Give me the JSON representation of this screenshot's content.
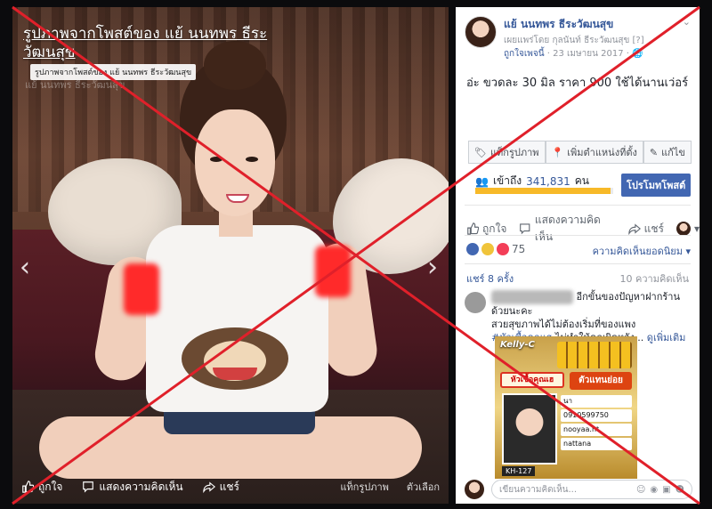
{
  "photo": {
    "title": "รูปภาพจากโพสต์ของ แย้ นนทพร ธีระวัฒนสุข",
    "caption_tag": "รูปภาพจากโพสต์ของ แย้ นนทพร ธีระวัฒนสุข",
    "sub_caption": "แย้ นนทพร ธีระวัฒนสุข",
    "bottom_bar": {
      "like": "ถูกใจ",
      "comment": "แสดงความคิดเห็น",
      "share": "แชร์",
      "tag_photo": "แท็กรูปภาพ",
      "options": "ตัวเลือก"
    },
    "nav_prev": "‹",
    "nav_next": "›"
  },
  "post": {
    "author": "แย้ นนทพร ธีระวัฒนสุข",
    "shared_by": "เผยแพร่โดย กุลนันท์ ธีระวัฒนสุข [?]",
    "page_liked": "ถูกใจเพจนี้",
    "date": "· 23 เมษายน 2017 · 🌐",
    "text": "อ่ะ ขวดละ 30 มิล ราคา 900 ใช้ได้นานเว่อร์"
  },
  "tags": {
    "tag_photo": "แท็กรูปภาพ",
    "add_location": "เพิ่มตำแหน่งที่ตั้ง",
    "edit": "แก้ไข"
  },
  "reach": {
    "label": "เข้าถึง",
    "count": "341,831",
    "unit": "คน",
    "fill_fraction": 0.98,
    "promote_button": "โปรโมทโพสต์"
  },
  "actions": {
    "like": "ถูกใจ",
    "comment": "แสดงความคิดเห็น",
    "share": "แชร์"
  },
  "reactions": {
    "count": "75",
    "sort_label": "ความคิดเห็นยอดนิยม ▾"
  },
  "stats": {
    "shares": "แชร์ 8 ครั้ง",
    "comments": "10 ความคิดเห็น"
  },
  "comment": {
    "line1": " อีกขั้นของปัญหาฝากร้านด้วยนะคะ",
    "line2": "สวยสุขภาพได้ไม่ต้องเริ่มที่ของแพง",
    "line3_hashtag": "#หัวเชื้อคุณเฮ",
    "line3_rest": " ไม่ทำให้คุณผิดหวัง... ",
    "see_more": "ดูเพิ่มเติม"
  },
  "ad": {
    "brand": "Kelly-C",
    "headline": "หัวเชื้อคุณเฮ",
    "agent": "ตัวแทนย่อย",
    "name": "นา",
    "phone": "0910599750",
    "id1": "nooyaa.nt",
    "id2": "nattana",
    "code": "KH-127"
  },
  "comment_box": {
    "placeholder": "เขียนความคิดเห็น..."
  },
  "colors": {
    "link_blue": "#365899",
    "promote_blue": "#4267b2",
    "reach_fill": "#f7b928",
    "x_red": "#e0202a"
  }
}
